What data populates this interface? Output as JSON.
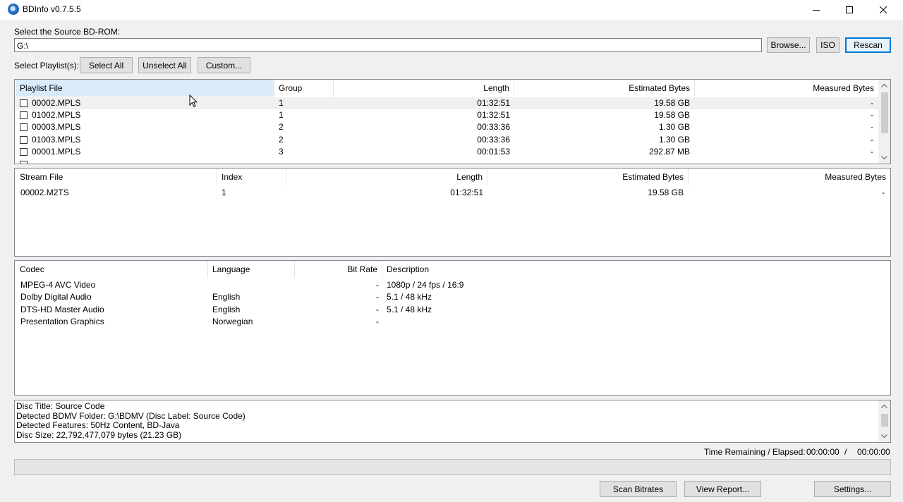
{
  "window": {
    "title": "BDInfo v0.7.5.5"
  },
  "source": {
    "label": "Select the Source BD-ROM:",
    "path": "G:\\",
    "browse_label": "Browse...",
    "iso_label": "ISO",
    "rescan_label": "Rescan"
  },
  "playlist_controls": {
    "label": "Select Playlist(s):",
    "select_all_label": "Select All",
    "unselect_all_label": "Unselect All",
    "custom_label": "Custom..."
  },
  "playlists": {
    "columns": [
      "Playlist File",
      "Group",
      "Length",
      "Estimated Bytes",
      "Measured Bytes"
    ],
    "rows": [
      {
        "file": "00002.MPLS",
        "group": "1",
        "length": "01:32:51",
        "estimated": "19.58 GB",
        "measured": "-"
      },
      {
        "file": "01002.MPLS",
        "group": "1",
        "length": "01:32:51",
        "estimated": "19.58 GB",
        "measured": "-"
      },
      {
        "file": "00003.MPLS",
        "group": "2",
        "length": "00:33:36",
        "estimated": "1.30 GB",
        "measured": "-"
      },
      {
        "file": "01003.MPLS",
        "group": "2",
        "length": "00:33:36",
        "estimated": "1.30 GB",
        "measured": "-"
      },
      {
        "file": "00001.MPLS",
        "group": "3",
        "length": "00:01:53",
        "estimated": "292.87 MB",
        "measured": "-"
      }
    ]
  },
  "streams": {
    "columns": [
      "Stream File",
      "Index",
      "Length",
      "Estimated Bytes",
      "Measured Bytes"
    ],
    "rows": [
      {
        "file": "00002.M2TS",
        "index": "1",
        "length": "01:32:51",
        "estimated": "19.58 GB",
        "measured": "-"
      }
    ]
  },
  "codecs": {
    "columns": [
      "Codec",
      "Language",
      "Bit Rate",
      "Description"
    ],
    "rows": [
      {
        "codec": "MPEG-4 AVC Video",
        "language": "",
        "bitrate": "-",
        "description": "1080p / 24 fps / 16:9"
      },
      {
        "codec": "Dolby Digital Audio",
        "language": "English",
        "bitrate": "-",
        "description": "5.1 / 48 kHz"
      },
      {
        "codec": "DTS-HD Master Audio",
        "language": "English",
        "bitrate": "-",
        "description": "5.1 / 48 kHz"
      },
      {
        "codec": "Presentation Graphics",
        "language": "Norwegian",
        "bitrate": "-",
        "description": ""
      }
    ]
  },
  "info": {
    "lines": [
      "Disc Title: Source Code",
      "Detected BDMV Folder: G:\\BDMV (Disc Label: Source Code)",
      "Detected Features: 50Hz Content, BD-Java",
      "Disc Size: 22,792,477,079 bytes (21.23 GB)"
    ]
  },
  "status": {
    "time_label": "Time Remaining / Elapsed:",
    "remaining": "00:00:00",
    "separator": "/",
    "elapsed": "00:00:00",
    "progress": 0
  },
  "footer": {
    "scan_label": "Scan Bitrates",
    "report_label": "View Report...",
    "settings_label": "Settings..."
  },
  "colors": {
    "accent": "#0078d7",
    "header_highlight": "#d9ebf9",
    "progress_fill": "#06b025"
  }
}
